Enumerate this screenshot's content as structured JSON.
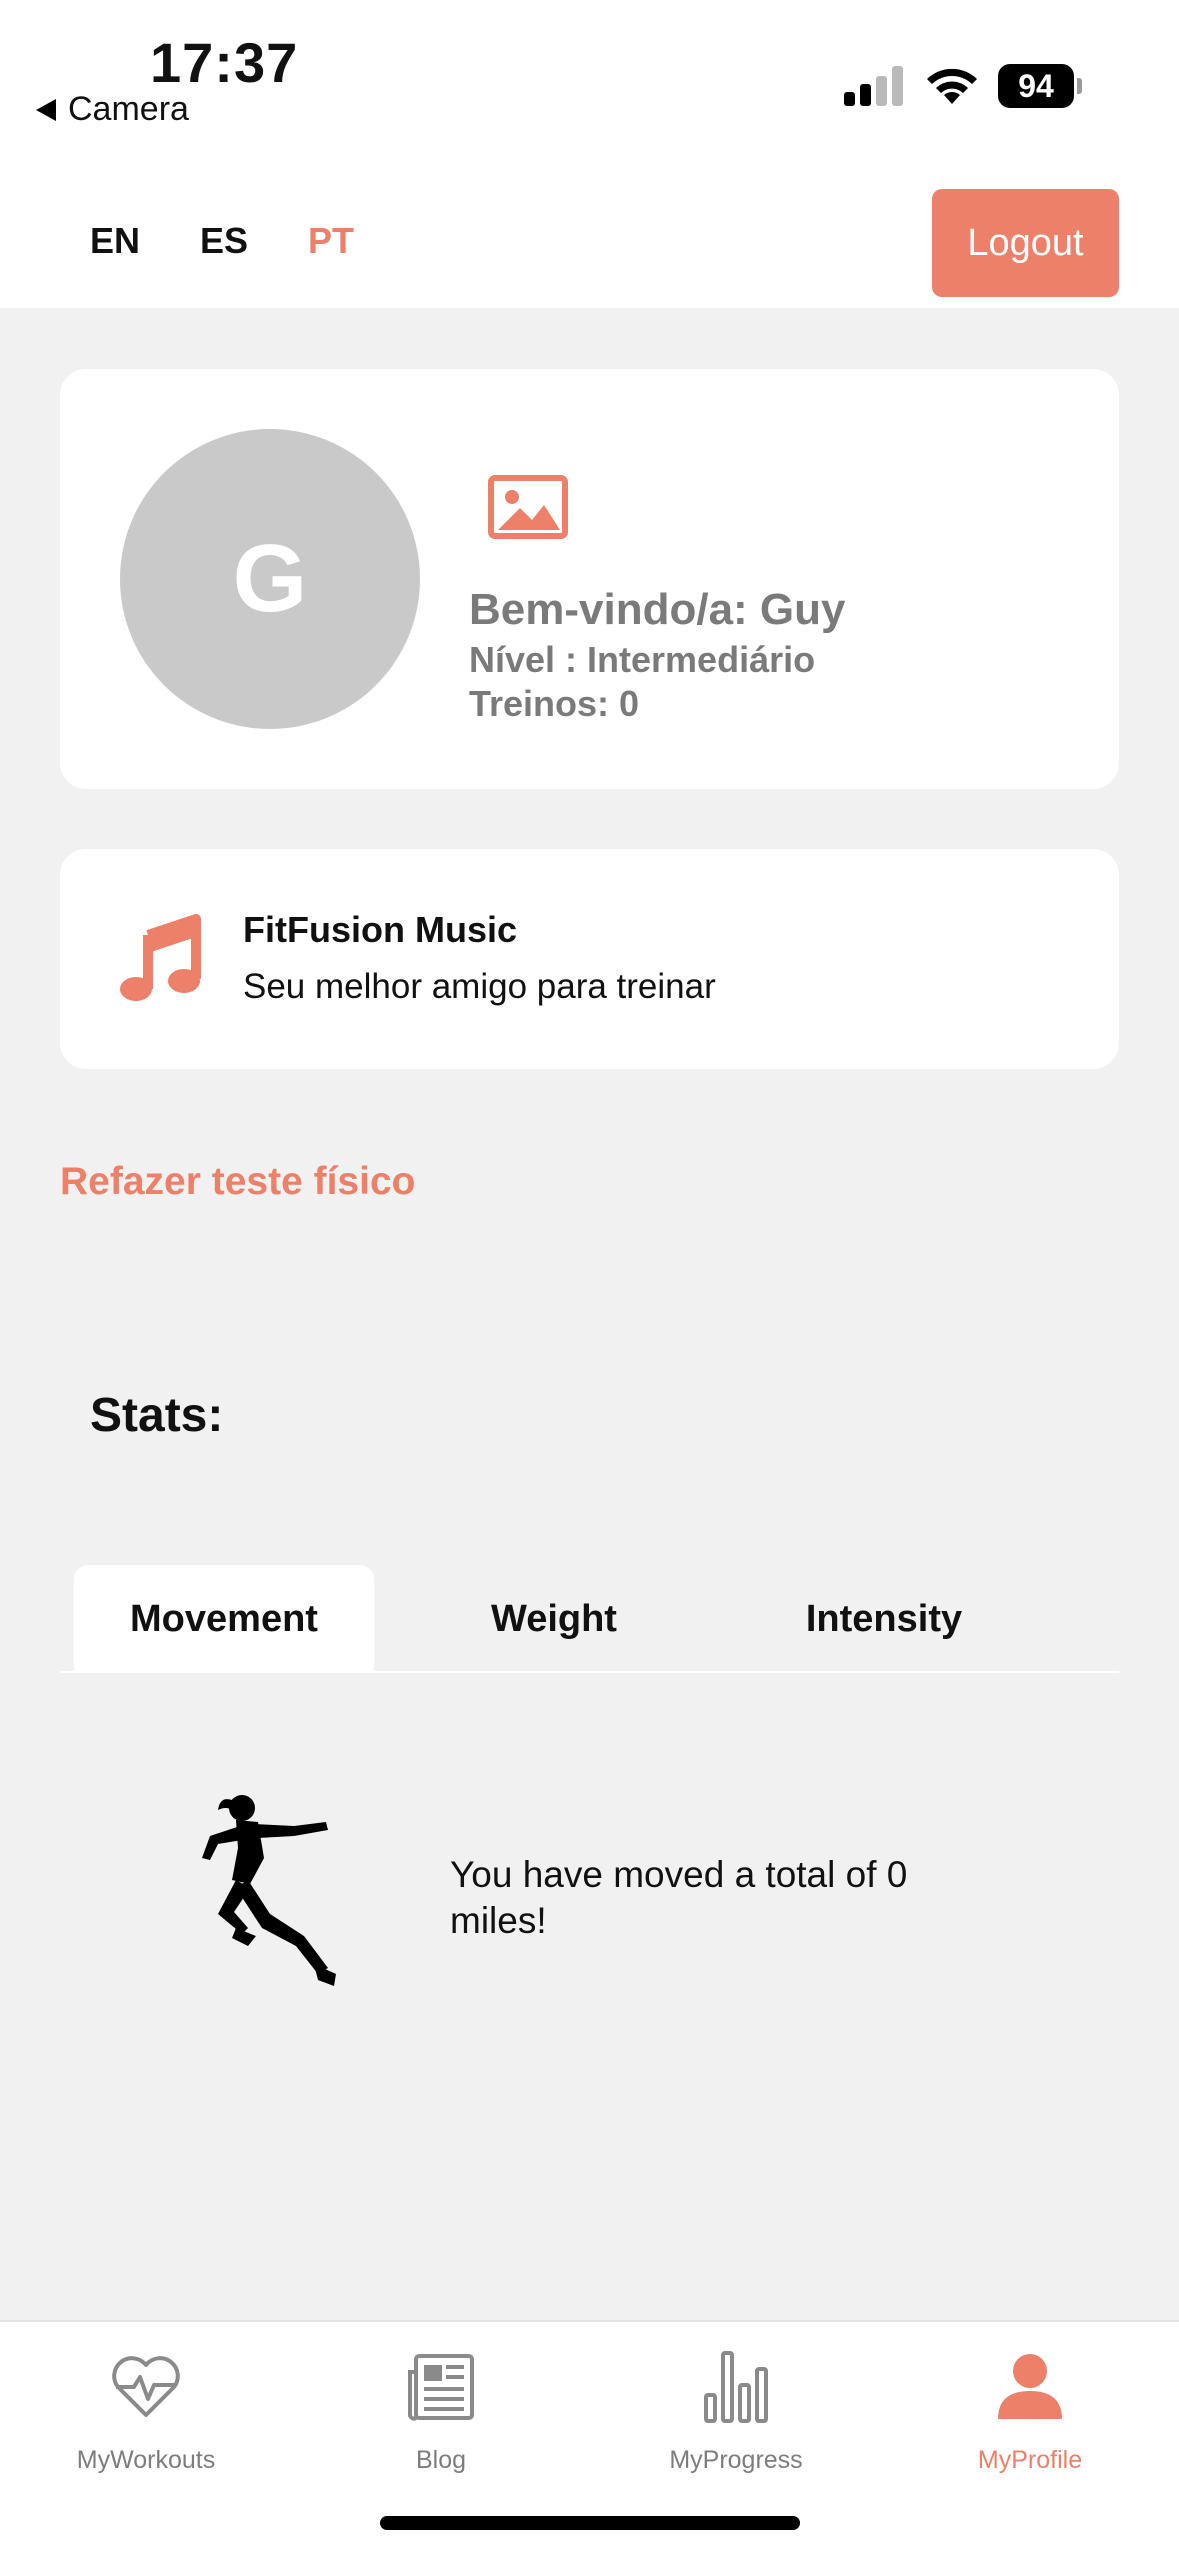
{
  "status_bar": {
    "time": "17:37",
    "back_app": "Camera",
    "battery": "94"
  },
  "header": {
    "languages": [
      {
        "code": "EN",
        "active": false
      },
      {
        "code": "ES",
        "active": false
      },
      {
        "code": "PT",
        "active": true
      }
    ],
    "logout_label": "Logout"
  },
  "profile": {
    "avatar_initial": "G",
    "welcome": "Bem-vindo/a: Guy",
    "level": "Nível : Intermediário",
    "workouts": "Treinos: 0",
    "image_icon": "image-icon"
  },
  "music": {
    "title": "FitFusion Music",
    "subtitle": "Seu melhor amigo para treinar",
    "icon": "music-note-icon"
  },
  "retest_link": "Refazer teste físico",
  "stats": {
    "title": "Stats:",
    "tabs": [
      {
        "label": "Movement",
        "active": true
      },
      {
        "label": "Weight",
        "active": false
      },
      {
        "label": "Intensity",
        "active": false
      }
    ],
    "movement_text": "You have moved a total of 0 miles!"
  },
  "bottom_nav": {
    "items": [
      {
        "label": "MyWorkouts",
        "icon": "heart-pulse-icon",
        "active": false
      },
      {
        "label": "Blog",
        "icon": "newspaper-icon",
        "active": false
      },
      {
        "label": "MyProgress",
        "icon": "bar-chart-icon",
        "active": false
      },
      {
        "label": "MyProfile",
        "icon": "user-icon",
        "active": true
      }
    ]
  },
  "colors": {
    "accent": "#ec8068",
    "background": "#f1f1f1",
    "card": "#ffffff",
    "avatar": "#c9c9c9",
    "muted_text": "#7a7a7a"
  }
}
